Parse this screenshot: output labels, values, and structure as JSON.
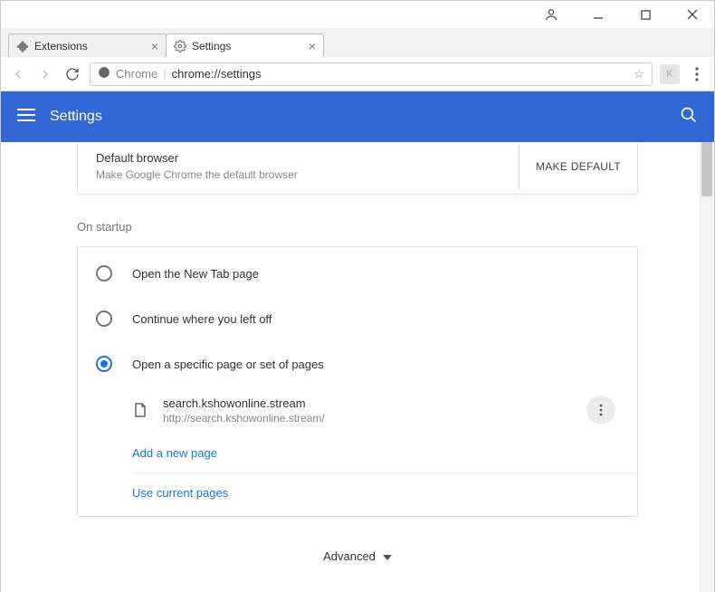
{
  "window": {
    "controls": [
      "account",
      "minimize",
      "maximize",
      "close"
    ]
  },
  "tabs": [
    {
      "label": "Extensions",
      "active": false,
      "icon": "puzzle"
    },
    {
      "label": "Settings",
      "active": true,
      "icon": "gear"
    }
  ],
  "addressbar": {
    "origin_label": "Chrome",
    "url_display": "chrome://settings"
  },
  "header": {
    "title": "Settings"
  },
  "default_browser": {
    "title": "Default browser",
    "subtitle": "Make Google Chrome the default browser",
    "button_label": "MAKE DEFAULT"
  },
  "startup": {
    "section_label": "On startup",
    "options": [
      {
        "label": "Open the New Tab page",
        "selected": false
      },
      {
        "label": "Continue where you left off",
        "selected": false
      },
      {
        "label": "Open a specific page or set of pages",
        "selected": true
      }
    ],
    "page_entry": {
      "title": "search.kshowonline.stream",
      "url": "http://search.kshowonline.stream/"
    },
    "add_new_page_label": "Add a new page",
    "use_current_pages_label": "Use current pages"
  },
  "advanced_label": "Advanced",
  "colors": {
    "primary": "#3367d6",
    "accent": "#1a73e8"
  }
}
